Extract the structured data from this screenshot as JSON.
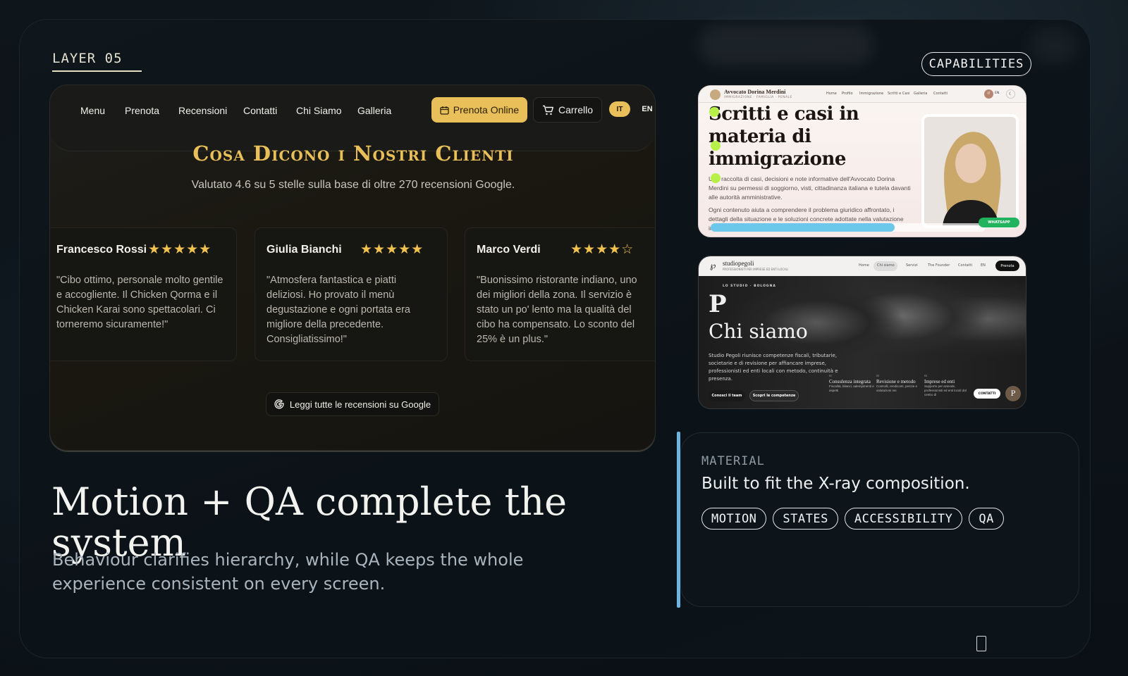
{
  "layer_label": "LAYER 05",
  "capabilities_label": "CAPABILITIES",
  "restaurant_site": {
    "nav": [
      "Menu",
      "Prenota",
      "Recensioni",
      "Contatti",
      "Chi Siamo",
      "Galleria"
    ],
    "book_button": "Prenota Online",
    "cart_button": "Carrello",
    "lang_active": "IT",
    "lang_other": "EN",
    "reviews_title": "Cosa Dicono i Nostri Clienti",
    "reviews_subtitle": "Valutato 4.6 su 5 stelle sulla base di oltre 270 recensioni Google.",
    "reviews": [
      {
        "name": "Francesco Rossi",
        "rating": 5,
        "stars": "★★★★★",
        "text": "\"Cibo ottimo, personale molto gentile e accogliente. Il Chicken Qorma e il Chicken Karai sono spettacolari. Ci torneremo sicuramente!\""
      },
      {
        "name": "Giulia Bianchi",
        "rating": 5,
        "stars": "★★★★★",
        "text": "\"Atmosfera fantastica e piatti deliziosi. Ho provato il menù degustazione e ogni portata era migliore della precedente. Consigliatissimo!\""
      },
      {
        "name": "Marco Verdi",
        "rating": 4,
        "stars": "★★★★☆",
        "text": "\"Buonissimo ristorante indiano, uno dei migliori della zona. Il servizio è stato un po' lento ma la qualità del cibo ha compensato. Lo sconto del 25% è un plus.\""
      }
    ],
    "google_button": "Leggi tutte le recensioni su Google"
  },
  "headline": "Motion + QA complete the system",
  "subline": "Behaviour clarifies hierarchy, while QA keeps the whole experience consistent on every screen.",
  "preview_lawyer": {
    "brand": "Avvocato Dorina Merdini",
    "brand_sub": "IMMIGRAZIONE · FAMIGLIA · PENALE",
    "nav": [
      "Home",
      "Profilo",
      "Immigrazione",
      "Scritti e Casi",
      "Galleria",
      "Contatti"
    ],
    "lang_it": "IT",
    "lang_en": "EN",
    "title": "Scritti e casi in materia di immigrazione",
    "text1": "Una raccolta di casi, decisioni e note informative dell'Avvocato Dorina Merdini su permessi di soggiorno, visti, cittadinanza italiana e tutela davanti alle autorità amministrative.",
    "text2": "Ogni contenuto aiuta a comprendere il problema giuridico affrontato, i dettagli della situazione e le soluzioni concrete adottate nella valutazione individuale della singola pratica.",
    "whatsapp": "WHATSAPP",
    "scroll_progress": 0.67
  },
  "preview_studio": {
    "brand": "studiopegoli",
    "brand_sub": "PROFESSIONISTI PER IMPRESE ED ENTI LOCALI",
    "nav": [
      "Home",
      "Chi siamo",
      "Servizi",
      "The Founder",
      "Contatti",
      "EN"
    ],
    "prenota": "Prenota",
    "kicker": "LO STUDIO · BOLOGNA",
    "monogram": "P",
    "title": "Chi siamo",
    "text": "Studio Pegoli riunisce competenze fiscali, tributarie, societarie e di revisione per affiancare imprese, professionisti ed enti locali con metodo, continuità e presenza.",
    "btn1": "Conosci il team",
    "btn2": "Scopri le competenze",
    "services": [
      {
        "num": "01",
        "title": "Consulenza integrata",
        "desc": "Fiscalità, bilanci, adempimenti e aspetti"
      },
      {
        "num": "02",
        "title": "Revisione e metodo",
        "desc": "Controlli, rendiconti, perizie e valutazioni nei"
      },
      {
        "num": "03",
        "title": "Imprese ed enti",
        "desc": "Supporto per aziende, professionisti ed enti locali dal centro di"
      }
    ],
    "contatti": "CONTATTI",
    "badge": "P"
  },
  "material": {
    "label": "MATERIAL",
    "title": "Built to fit the X-ray composition.",
    "tags": [
      "MOTION",
      "STATES",
      "ACCESSIBILITY",
      "QA"
    ]
  },
  "colors": {
    "gold": "#e9bf5a",
    "accent_blue": "#6fb4e0",
    "green_dot": "#b8f04a"
  }
}
